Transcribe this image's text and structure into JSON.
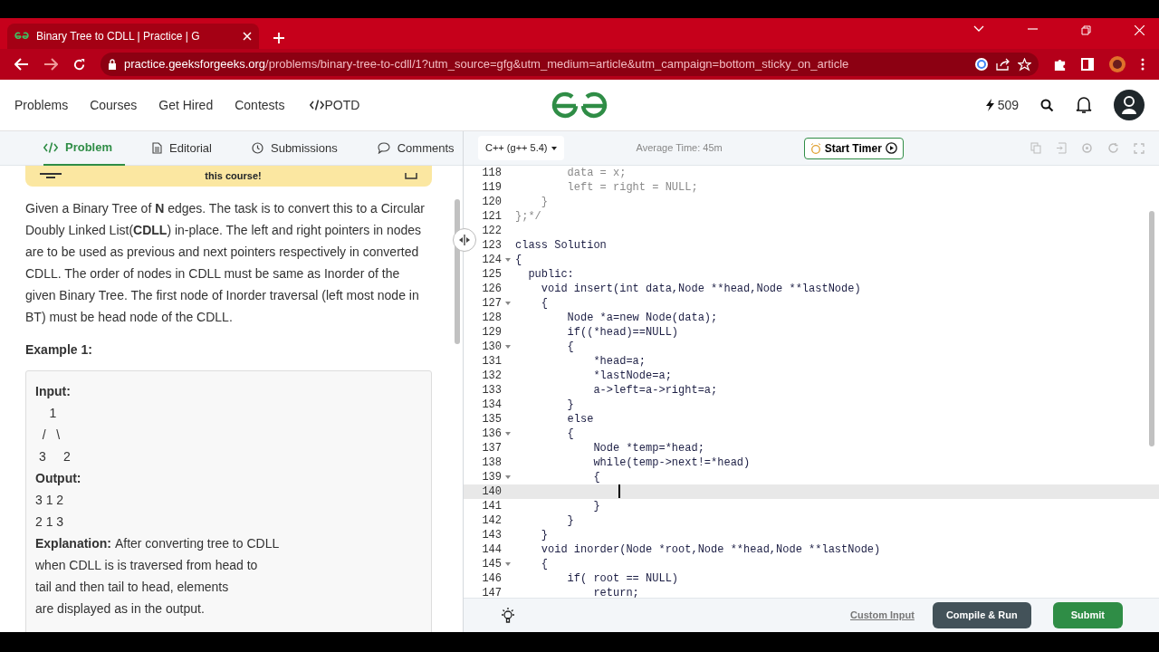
{
  "browser": {
    "tab": {
      "title": "Binary Tree to CDLL | Practice | G"
    },
    "address": {
      "host": "practice.geeksforgeeks.org",
      "path": "/problems/binary-tree-to-cdll/1?utm_source=gfg&utm_medium=article&utm_campaign=bottom_sticky_on_article"
    }
  },
  "site_nav": {
    "links": [
      "Problems",
      "Courses",
      "Get Hired",
      "Contests",
      "POTD"
    ],
    "streak": "509"
  },
  "problem_tabs": [
    {
      "label": "Problem",
      "selected": true
    },
    {
      "label": "Editorial",
      "selected": false
    },
    {
      "label": "Submissions",
      "selected": false
    },
    {
      "label": "Comments",
      "selected": false
    }
  ],
  "banner": {
    "text": "this course!"
  },
  "description": "Given a Binary Tree of **N** edges. The task is to convert this to a Circular Doubly Linked List(**CDLL**) in-place. The left and right pointers in nodes are to be used as previous and next pointers respectively in converted CDLL. The order of nodes in CDLL must be same as Inorder of the given Binary Tree. The first node of Inorder traversal (left most node in BT) must be head node of the CDLL.",
  "example": {
    "title": "Example 1:",
    "input_label": "Input:",
    "input_lines": [
      "    1",
      "  /   \\",
      " 3     2"
    ],
    "output_label": "Output:",
    "output_lines": [
      "3 1 2",
      "2 1 3"
    ],
    "explanation_label": "Explanation:",
    "explanation": "After converting tree to CDLL\nwhen CDLL is is traversed from head to\ntail and then tail to head, elements\nare displayed as in the output."
  },
  "editor": {
    "language": "C++ (g++ 5.4)",
    "average_time": "Average Time: 45m",
    "timer_button": "Start Timer",
    "lines": [
      {
        "n": "118",
        "text": "        data = x;",
        "kind": "comment",
        "fold": false,
        "current": false
      },
      {
        "n": "119",
        "text": "        left = right = NULL;",
        "kind": "comment",
        "fold": false,
        "current": false
      },
      {
        "n": "120",
        "text": "    }",
        "kind": "comment",
        "fold": false,
        "current": false
      },
      {
        "n": "121",
        "text": "};*/",
        "kind": "comment",
        "fold": false,
        "current": false
      },
      {
        "n": "122",
        "kind": "code",
        "fold": false,
        "current": false
      },
      {
        "n": "123",
        "text": "class Solution",
        "kind": "code",
        "fold": false,
        "current": false
      },
      {
        "n": "124",
        "text": "{",
        "kind": "code",
        "fold": true,
        "current": false
      },
      {
        "n": "125",
        "text": "  public:",
        "kind": "code",
        "fold": false,
        "current": false
      },
      {
        "n": "126",
        "text": "    void insert(int data,Node **head,Node **lastNode)",
        "kind": "code",
        "fold": false,
        "current": false
      },
      {
        "n": "127",
        "text": "    {",
        "kind": "code",
        "fold": true,
        "current": false
      },
      {
        "n": "128",
        "text": "        Node *a=new Node(data);",
        "kind": "code",
        "fold": false,
        "current": false
      },
      {
        "n": "129",
        "text": "        if((*head)==NULL)",
        "kind": "code",
        "fold": false,
        "current": false
      },
      {
        "n": "130",
        "text": "        {",
        "kind": "code",
        "fold": true,
        "current": false
      },
      {
        "n": "131",
        "text": "            *head=a;",
        "kind": "code",
        "fold": false,
        "current": false
      },
      {
        "n": "132",
        "text": "            *lastNode=a;",
        "kind": "code",
        "fold": false,
        "current": false
      },
      {
        "n": "133",
        "text": "            a->left=a->right=a;",
        "kind": "code",
        "fold": false,
        "current": false
      },
      {
        "n": "134",
        "text": "        }",
        "kind": "code",
        "fold": false,
        "current": false
      },
      {
        "n": "135",
        "text": "        else",
        "kind": "code",
        "fold": false,
        "current": false
      },
      {
        "n": "136",
        "text": "        {",
        "kind": "code",
        "fold": true,
        "current": false
      },
      {
        "n": "137",
        "text": "            Node *temp=*head;",
        "kind": "code",
        "fold": false,
        "current": false
      },
      {
        "n": "138",
        "text": "            while(temp->next!=*head)",
        "kind": "code",
        "fold": false,
        "current": false
      },
      {
        "n": "139",
        "text": "            {",
        "kind": "code",
        "fold": true,
        "current": false
      },
      {
        "n": "140",
        "kind": "code",
        "fold": false,
        "current": true
      },
      {
        "n": "141",
        "text": "            }",
        "kind": "code",
        "fold": false,
        "current": false
      },
      {
        "n": "142",
        "text": "        }",
        "kind": "code",
        "fold": false,
        "current": false
      },
      {
        "n": "143",
        "text": "    }",
        "kind": "code",
        "fold": false,
        "current": false
      },
      {
        "n": "144",
        "text": "    void inorder(Node *root,Node **head,Node **lastNode)",
        "kind": "code",
        "fold": false,
        "current": false
      },
      {
        "n": "145",
        "text": "    {",
        "kind": "code",
        "fold": true,
        "current": false
      },
      {
        "n": "146",
        "text": "        if( root == NULL)",
        "kind": "code",
        "fold": false,
        "current": false
      },
      {
        "n": "147",
        "text": "            return;",
        "kind": "code",
        "fold": false,
        "current": false
      }
    ]
  },
  "footer": {
    "custom_input": "Custom Input",
    "compile": "Compile & Run",
    "submit": "Submit"
  }
}
